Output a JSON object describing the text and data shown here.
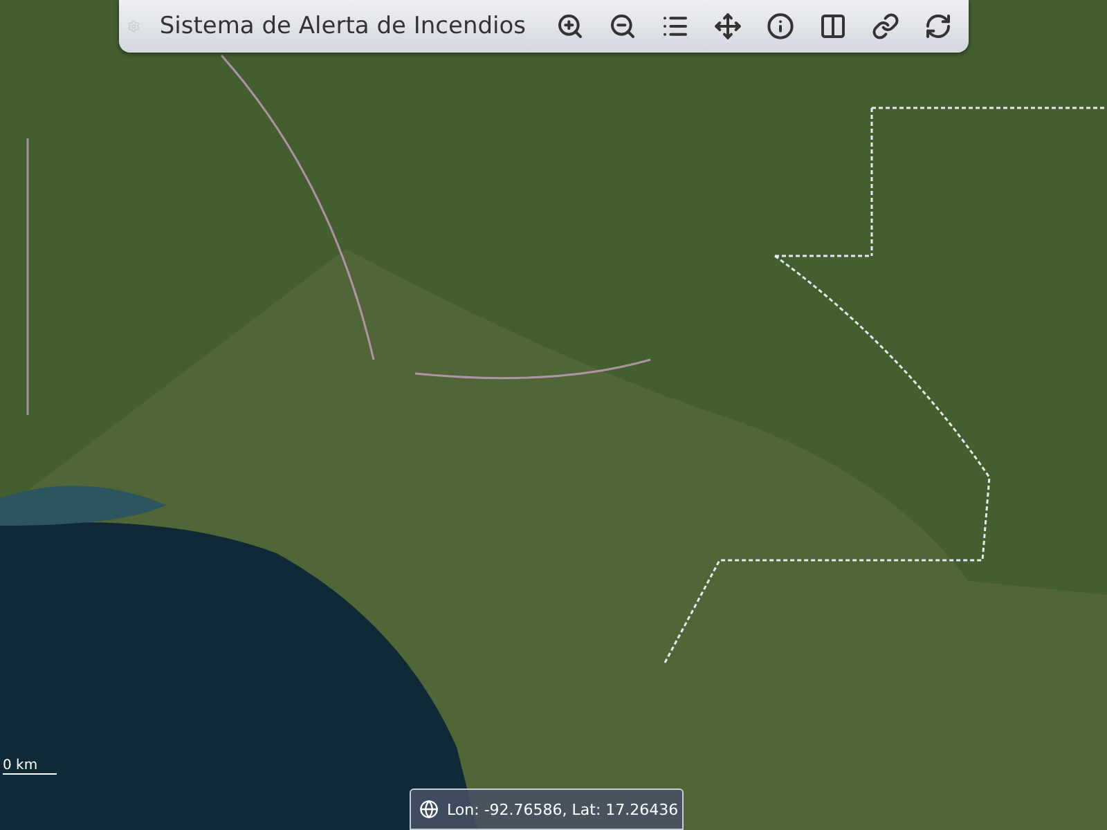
{
  "toolbar": {
    "title": "Sistema de Alerta de Incendios",
    "tools": [
      {
        "kind": "zoom-in"
      },
      {
        "kind": "zoom-out"
      },
      {
        "kind": "list"
      },
      {
        "kind": "pan"
      },
      {
        "kind": "info"
      },
      {
        "kind": "panel"
      },
      {
        "kind": "link"
      },
      {
        "kind": "refresh"
      }
    ]
  },
  "scale": {
    "label": "0 km"
  },
  "coordinates": {
    "text": "Lon: -92.76586, Lat: 17.26436"
  }
}
